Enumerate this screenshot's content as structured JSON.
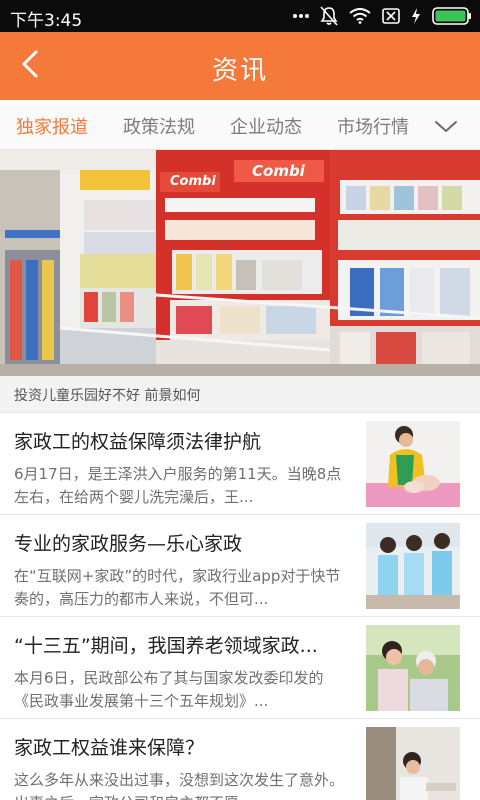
{
  "status_bar": {
    "time": "下午3:45",
    "icons": [
      "more-icon",
      "mute-icon",
      "wifi-icon",
      "sim-icon",
      "charging-icon",
      "battery-icon"
    ]
  },
  "header": {
    "title": "资讯",
    "back_icon": "chevron-left-icon",
    "color": "#f5793a"
  },
  "tabs": {
    "items": [
      {
        "label": "独家报道",
        "active": true
      },
      {
        "label": "政策法规",
        "active": false
      },
      {
        "label": "企业动态",
        "active": false
      },
      {
        "label": "市场行情",
        "active": false
      }
    ],
    "more_icon": "chevron-down-icon",
    "active_color": "#f5793a"
  },
  "banner": {
    "caption": "投资儿童乐园好不好 前景如何",
    "sign_texts": [
      "Combi",
      "Combi"
    ]
  },
  "news": [
    {
      "title": "家政工的权益保障须法律护航",
      "summary": "6月17日，是王泽洪入户服务的第11天。当晚8点左右，在给两个婴儿洗完澡后，王..."
    },
    {
      "title": "专业的家政服务—乐心家政",
      "summary": "在“互联网+家政”的时代，家政行业app对于快节奏的，高压力的都市人来说，不但可..."
    },
    {
      "title": "“十三五”期间，我国养老领域家政...",
      "summary": "本月6日，民政部公布了其与国家发改委印发的《民政事业发展第十三个五年规划》..."
    },
    {
      "title": "家政工权益谁来保障？",
      "summary": "这么多年从来没出过事，没想到这次发生了意外。出事之后，家政公司和雇主都不愿..."
    }
  ]
}
